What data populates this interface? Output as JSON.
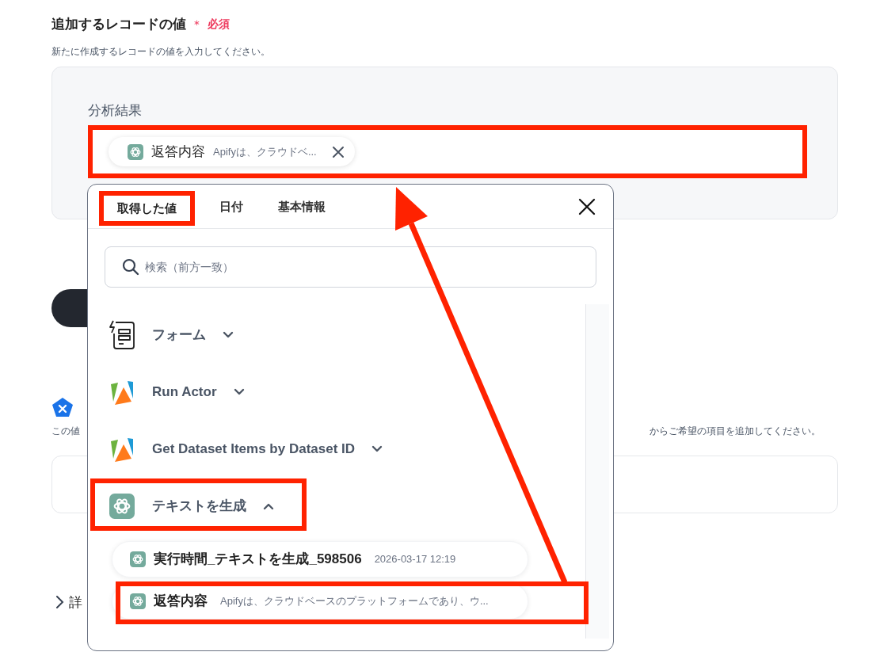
{
  "section": {
    "title": "追加するレコードの値",
    "required_mark": "＊",
    "required_label": "必須",
    "description": "新たに作成するレコードの値を入力してください。"
  },
  "field": {
    "label": "分析結果",
    "chip": {
      "name": "返答内容",
      "preview": "Apifyは、クラウドベ..."
    }
  },
  "background": {
    "description_start": "この値",
    "description_end": "からご希望の項目を追加してください。",
    "details_label": "詳"
  },
  "popup": {
    "tabs": [
      {
        "label": "取得した値",
        "selected": true
      },
      {
        "label": "日付",
        "selected": false
      },
      {
        "label": "基本情報",
        "selected": false
      }
    ],
    "search": {
      "placeholder": "検索（前方一致）"
    },
    "groups": [
      {
        "kind": "form",
        "label": "フォーム",
        "expanded": false
      },
      {
        "kind": "apify",
        "label": "Run Actor",
        "expanded": false
      },
      {
        "kind": "apify",
        "label": "Get Dataset Items by Dataset ID",
        "expanded": false
      },
      {
        "kind": "openai",
        "label": "テキストを生成",
        "expanded": true,
        "items": [
          {
            "name": "実行時間_テキストを生成_598506",
            "value": "2026-03-17 12:19"
          },
          {
            "name": "返答内容",
            "value": "Apifyは、クラウドベースのプラットフォームであり、ウ..."
          }
        ]
      }
    ]
  }
}
